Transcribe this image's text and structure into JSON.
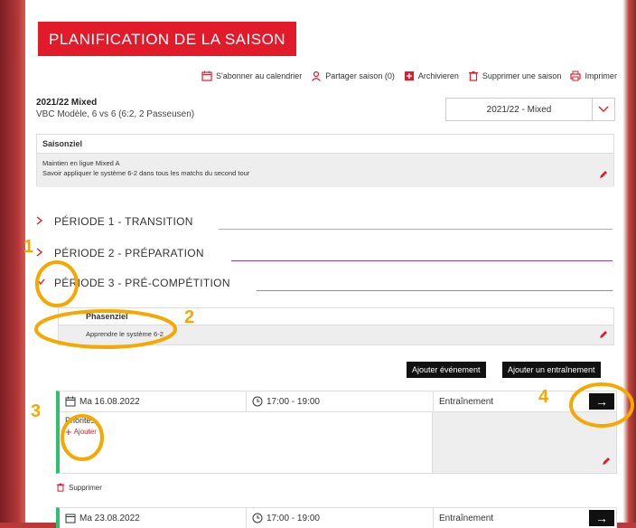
{
  "title": "PLANIFICATION DE LA SAISON",
  "toolbar": {
    "subscribe": "S'abonner au calendrier",
    "share": "Partager saison (0)",
    "archive": "Archivieren",
    "delete": "Supprimer une saison",
    "print": "Imprimer"
  },
  "season": {
    "name": "2021/22 Mixed",
    "team": "VBC Modèle, 6 vs 6 (6:2, 2 Passeusen)",
    "selected": "2021/22 - Mixed"
  },
  "season_goal": {
    "header": "Saisonziel",
    "line1": "Maintien en ligue Mixed A",
    "line2": "Savoir appliquer le système 6-2 dans tous les matchs du second tour"
  },
  "periods": [
    {
      "label": "PÉRIODE 1 - TRANSITION",
      "color": "#5bc8e6"
    },
    {
      "label": "PÉRIODE 2 - PRÉPARATION",
      "color": "#8e3fa6"
    },
    {
      "label": "PÉRIODE 3 - PRÉ-COMPÉTITION",
      "color": "#2fbf8f"
    }
  ],
  "phase_goal": {
    "header": "Phasenziel",
    "text": "Apprendre le système 6-2"
  },
  "buttons": {
    "add_event": "Ajouter événement",
    "add_training": "Ajouter un entraînement"
  },
  "sessions": [
    {
      "date": "Ma 16.08.2022",
      "time": "17:00 - 19:00",
      "type": "Entraînement"
    },
    {
      "date": "Ma 23.08.2022",
      "time": "17:00 - 19:00",
      "type": "Entraînement"
    }
  ],
  "priorities": {
    "label": "Priorités",
    "add": "Ajouter"
  },
  "delete_session": "Supprimer",
  "annotations": [
    "1",
    "2",
    "3",
    "4"
  ],
  "colors": {
    "accent": "#e11b2a",
    "highlight": "#f5a800",
    "session_bar": "#2fbf71"
  }
}
